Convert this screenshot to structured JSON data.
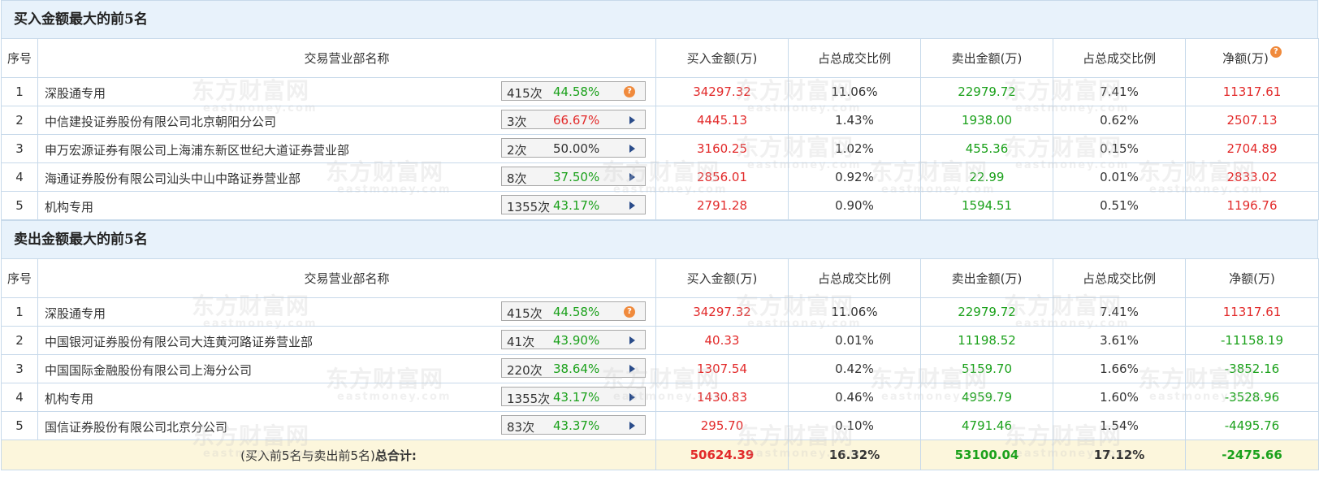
{
  "buy_section": {
    "title": "买入金额最大的前5名",
    "headers": {
      "seq": "序号",
      "name": "交易营业部名称",
      "buy": "买入金额(万)",
      "buy_pct": "占总成交比例",
      "sell": "卖出金额(万)",
      "sell_pct": "占总成交比例",
      "net": "净额(万)"
    },
    "rows": [
      {
        "seq": "1",
        "name": "深股通专用",
        "count": "415次",
        "rate": "44.58%",
        "rate_color": "green",
        "icon": "question-icon",
        "buy": "34297.32",
        "buy_pct": "11.06%",
        "sell": "22979.72",
        "sell_pct": "7.41%",
        "net": "11317.61",
        "net_color": "red"
      },
      {
        "seq": "2",
        "name": "中信建投证券股份有限公司北京朝阳分公司",
        "count": "3次",
        "rate": "66.67%",
        "rate_color": "red",
        "icon": "arrow-right-icon",
        "buy": "4445.13",
        "buy_pct": "1.43%",
        "sell": "1938.00",
        "sell_pct": "0.62%",
        "net": "2507.13",
        "net_color": "red"
      },
      {
        "seq": "3",
        "name": "申万宏源证券有限公司上海浦东新区世纪大道证券营业部",
        "count": "2次",
        "rate": "50.00%",
        "rate_color": "dark",
        "icon": "arrow-right-icon",
        "buy": "3160.25",
        "buy_pct": "1.02%",
        "sell": "455.36",
        "sell_pct": "0.15%",
        "net": "2704.89",
        "net_color": "red"
      },
      {
        "seq": "4",
        "name": "海通证券股份有限公司汕头中山中路证券营业部",
        "count": "8次",
        "rate": "37.50%",
        "rate_color": "green",
        "icon": "arrow-right-icon",
        "buy": "2856.01",
        "buy_pct": "0.92%",
        "sell": "22.99",
        "sell_pct": "0.01%",
        "net": "2833.02",
        "net_color": "red"
      },
      {
        "seq": "5",
        "name": "机构专用",
        "count": "1355次",
        "rate": "43.17%",
        "rate_color": "green",
        "icon": "arrow-right-icon",
        "buy": "2791.28",
        "buy_pct": "0.90%",
        "sell": "1594.51",
        "sell_pct": "0.51%",
        "net": "1196.76",
        "net_color": "red"
      }
    ]
  },
  "sell_section": {
    "title": "卖出金额最大的前5名",
    "headers": {
      "seq": "序号",
      "name": "交易营业部名称",
      "buy": "买入金额(万)",
      "buy_pct": "占总成交比例",
      "sell": "卖出金额(万)",
      "sell_pct": "占总成交比例",
      "net": "净额(万)"
    },
    "rows": [
      {
        "seq": "1",
        "name": "深股通专用",
        "count": "415次",
        "rate": "44.58%",
        "rate_color": "green",
        "icon": "question-icon",
        "buy": "34297.32",
        "buy_pct": "11.06%",
        "sell": "22979.72",
        "sell_pct": "7.41%",
        "net": "11317.61",
        "net_color": "red"
      },
      {
        "seq": "2",
        "name": "中国银河证券股份有限公司大连黄河路证券营业部",
        "count": "41次",
        "rate": "43.90%",
        "rate_color": "green",
        "icon": "arrow-right-icon",
        "buy": "40.33",
        "buy_pct": "0.01%",
        "sell": "11198.52",
        "sell_pct": "3.61%",
        "net": "-11158.19",
        "net_color": "green"
      },
      {
        "seq": "3",
        "name": "中国国际金融股份有限公司上海分公司",
        "count": "220次",
        "rate": "38.64%",
        "rate_color": "green",
        "icon": "arrow-right-icon",
        "buy": "1307.54",
        "buy_pct": "0.42%",
        "sell": "5159.70",
        "sell_pct": "1.66%",
        "net": "-3852.16",
        "net_color": "green"
      },
      {
        "seq": "4",
        "name": "机构专用",
        "count": "1355次",
        "rate": "43.17%",
        "rate_color": "green",
        "icon": "arrow-right-icon",
        "buy": "1430.83",
        "buy_pct": "0.46%",
        "sell": "4959.79",
        "sell_pct": "1.60%",
        "net": "-3528.96",
        "net_color": "green"
      },
      {
        "seq": "5",
        "name": "国信证券股份有限公司北京分公司",
        "count": "83次",
        "rate": "43.37%",
        "rate_color": "green",
        "icon": "arrow-right-icon",
        "buy": "295.70",
        "buy_pct": "0.10%",
        "sell": "4791.46",
        "sell_pct": "1.54%",
        "net": "-4495.76",
        "net_color": "green"
      }
    ],
    "total": {
      "label_prefix": "(买入前5名与卖出前5名)",
      "label_bold": "总合计:",
      "buy": "50624.39",
      "buy_pct": "16.32%",
      "sell": "53100.04",
      "sell_pct": "17.12%",
      "net": "-2475.66"
    }
  },
  "watermark": {
    "brand": "东方财富网",
    "domain": "eastmoney.com"
  },
  "colors": {
    "red": "#e22a2a",
    "green": "#1ba11b",
    "header_bg": "#e8f2fb",
    "total_bg": "#fcf6dc",
    "border": "#c7d9ea"
  }
}
